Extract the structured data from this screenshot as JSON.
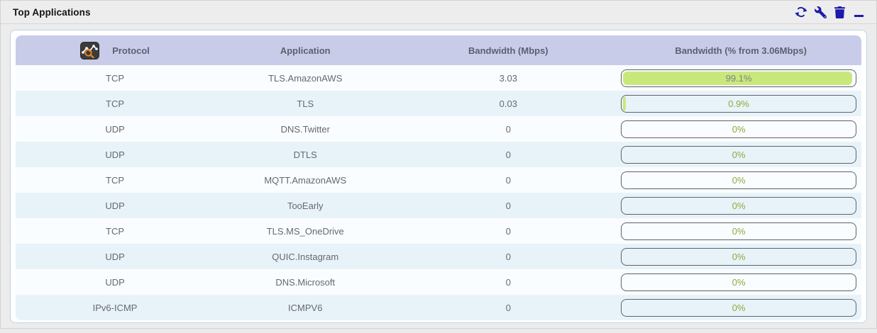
{
  "widget": {
    "title": "Top Applications",
    "toolbar": {
      "icons": [
        "refresh",
        "wrench",
        "trash",
        "minimize"
      ]
    }
  },
  "table": {
    "header": {
      "protocol": "Protocol",
      "application": "Application",
      "bandwidth_mbps": "Bandwidth (Mbps)",
      "bandwidth_pct": "Bandwidth (% from 3.06Mbps)"
    },
    "rows": [
      {
        "protocol": "TCP",
        "application": "TLS.AmazonAWS",
        "bandwidth_mbps": "3.03",
        "bandwidth_pct_label": "99.1%",
        "bandwidth_pct_value": 99.1
      },
      {
        "protocol": "TCP",
        "application": "TLS",
        "bandwidth_mbps": "0.03",
        "bandwidth_pct_label": "0.9%",
        "bandwidth_pct_value": 0.9
      },
      {
        "protocol": "UDP",
        "application": "DNS.Twitter",
        "bandwidth_mbps": "0",
        "bandwidth_pct_label": "0%",
        "bandwidth_pct_value": 0
      },
      {
        "protocol": "UDP",
        "application": "DTLS",
        "bandwidth_mbps": "0",
        "bandwidth_pct_label": "0%",
        "bandwidth_pct_value": 0
      },
      {
        "protocol": "TCP",
        "application": "MQTT.AmazonAWS",
        "bandwidth_mbps": "0",
        "bandwidth_pct_label": "0%",
        "bandwidth_pct_value": 0
      },
      {
        "protocol": "UDP",
        "application": "TooEarly",
        "bandwidth_mbps": "0",
        "bandwidth_pct_label": "0%",
        "bandwidth_pct_value": 0
      },
      {
        "protocol": "TCP",
        "application": "TLS.MS_OneDrive",
        "bandwidth_mbps": "0",
        "bandwidth_pct_label": "0%",
        "bandwidth_pct_value": 0
      },
      {
        "protocol": "UDP",
        "application": "QUIC.Instagram",
        "bandwidth_mbps": "0",
        "bandwidth_pct_label": "0%",
        "bandwidth_pct_value": 0
      },
      {
        "protocol": "UDP",
        "application": "DNS.Microsoft",
        "bandwidth_mbps": "0",
        "bandwidth_pct_label": "0%",
        "bandwidth_pct_value": 0
      },
      {
        "protocol": "IPv6-ICMP",
        "application": "ICMPV6",
        "bandwidth_mbps": "0",
        "bandwidth_pct_label": "0%",
        "bandwidth_pct_value": 0
      }
    ]
  },
  "colors": {
    "bar_fill": "#c9e87b",
    "bar_border": "#5d6268",
    "pct_text_green": "#8fa83b",
    "pct_text_gray": "#7b828b",
    "header_bg": "#c9cce8",
    "row_alt_bg": "#e8f3f9",
    "icon_color": "#1c1ca8"
  }
}
